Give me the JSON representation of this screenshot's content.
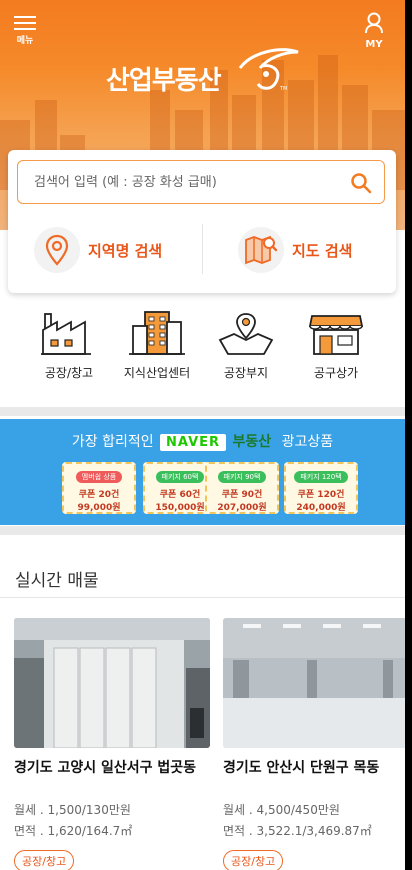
{
  "header": {
    "menu_label": "메뉴",
    "my_label": "MY",
    "logo_text": "산업부동산",
    "logo_tm": "TM"
  },
  "search": {
    "placeholder": "검색어 입력 (예 : 공장 화성 급매)",
    "region_label": "지역명 검색",
    "map_label": "지도 검색"
  },
  "categories": [
    {
      "label": "공장/창고",
      "icon": "factory-icon"
    },
    {
      "label": "지식산업센터",
      "icon": "building-icon"
    },
    {
      "label": "공장부지",
      "icon": "land-map-icon"
    },
    {
      "label": "공구상가",
      "icon": "store-icon"
    }
  ],
  "banner": {
    "prefix": "가장 합리적인",
    "brand": "NAVER",
    "brand_sub": "부동산",
    "suffix": "광고상품",
    "coupons": [
      {
        "tag": "멤버쉽 상품",
        "line1": "쿠폰 20건",
        "line2": "99,000원",
        "color": "#ef5a5a"
      },
      {
        "tag": "패키지 60택",
        "line1": "쿠폰 60건",
        "line2": "150,000원",
        "color": "#3bbf5c"
      },
      {
        "tag": "패키지 90택",
        "line1": "쿠폰 90건",
        "line2": "207,000원",
        "color": "#3bbf5c"
      },
      {
        "tag": "패키지 120택",
        "line1": "쿠폰 120건",
        "line2": "240,000원",
        "color": "#3bbf5c"
      }
    ]
  },
  "realtime": {
    "title": "실시간 매물",
    "listings": [
      {
        "title": "경기도 고양시 일산서구 법곳동",
        "rent": "월세 . 1,500/130만원",
        "area": "면적 . 1,620/164.7㎡",
        "category": "공장/창고"
      },
      {
        "title": "경기도 안산시 단원구 목동",
        "rent": "월세 . 4,500/450만원",
        "area": "면적 . 3,522.1/3,469.87㎡",
        "category": "공장/창고"
      }
    ]
  },
  "colors": {
    "brand_orange": "#f47b20",
    "accent_text": "#e8571a",
    "banner_blue": "#39a1e6",
    "naver_green": "#1ec800"
  }
}
